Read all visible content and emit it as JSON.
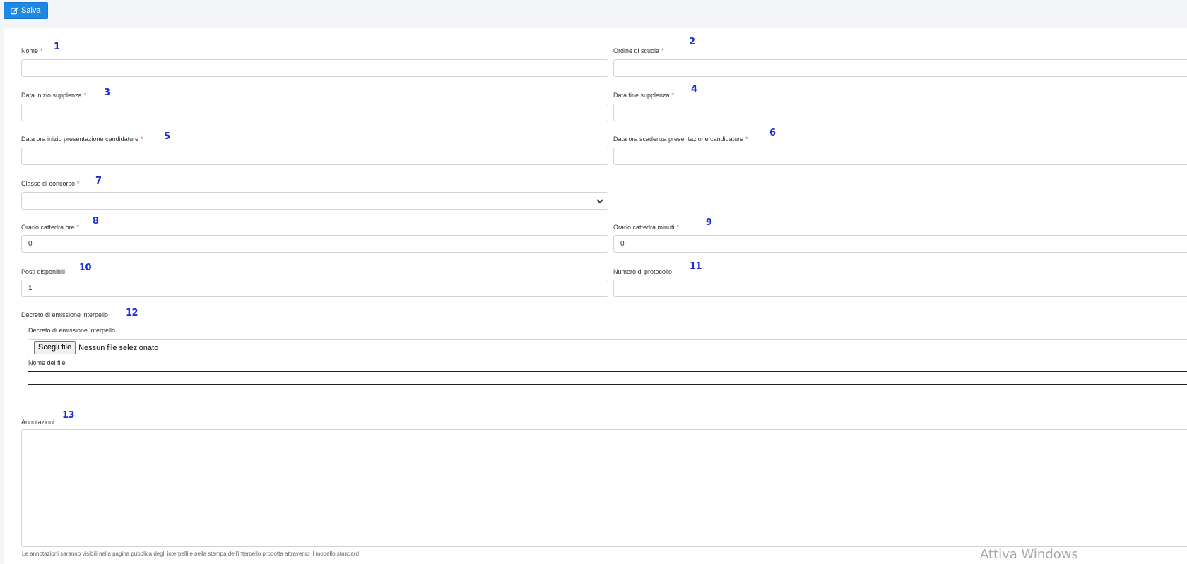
{
  "toolbar": {
    "save_label": "Salva"
  },
  "fields": {
    "nome": {
      "label": "Nome",
      "required": "*",
      "number": "1",
      "value": ""
    },
    "ordine_di_scuola": {
      "label": "Ordine di scuola",
      "required": "*",
      "number": "2",
      "value": ""
    },
    "data_inizio_supplenza": {
      "label": "Data inizio supplenza",
      "required": "*",
      "number": "3",
      "value": ""
    },
    "data_fine_supplenza": {
      "label": "Data fine supplenza",
      "required": "*",
      "number": "4",
      "value": ""
    },
    "data_ora_inizio_presentazione": {
      "label": "Data ora inizio presentazione candidature",
      "required": "*",
      "number": "5",
      "value": ""
    },
    "data_ora_scadenza_presentazione": {
      "label": "Data ora scadenza presentazione candidature",
      "required": "*",
      "number": "6",
      "value": ""
    },
    "classe_di_concorso": {
      "label": "Classe di concorso",
      "required": "*",
      "number": "7",
      "value": ""
    },
    "orario_cattedra_ore": {
      "label": "Orario cattedra ore",
      "required": "*",
      "number": "8",
      "value": "0"
    },
    "orario_cattedra_minuti": {
      "label": "Orario cattedra minuti",
      "required": "*",
      "number": "9",
      "value": "0"
    },
    "posti_disponibili": {
      "label": "Posti disponibili",
      "number": "10",
      "value": "1"
    },
    "numero_di_protocollo": {
      "label": "Numero di protocollo",
      "number": "11",
      "value": ""
    },
    "decreto": {
      "label": "Decreto di emissione interpello",
      "number": "12",
      "sub_label": "Decreto di emissione interpello",
      "file_button": "Scegli file",
      "file_status": "Nessun file selezionato",
      "filename_label": "Nome del file",
      "filename_value": ""
    },
    "annotazioni": {
      "label": "Annotazioni",
      "number": "13",
      "value": "",
      "help": "Le annotazioni saranno visibili nella pagina pubblica degli interpelli e nella stampa dell'interpello prodotta attraverso il modello standard"
    }
  },
  "watermark": "Attiva Windows",
  "colors": {
    "primary": "#1e88e5",
    "required": "#e53935",
    "annotation_numbers": "#1a2bd8"
  }
}
